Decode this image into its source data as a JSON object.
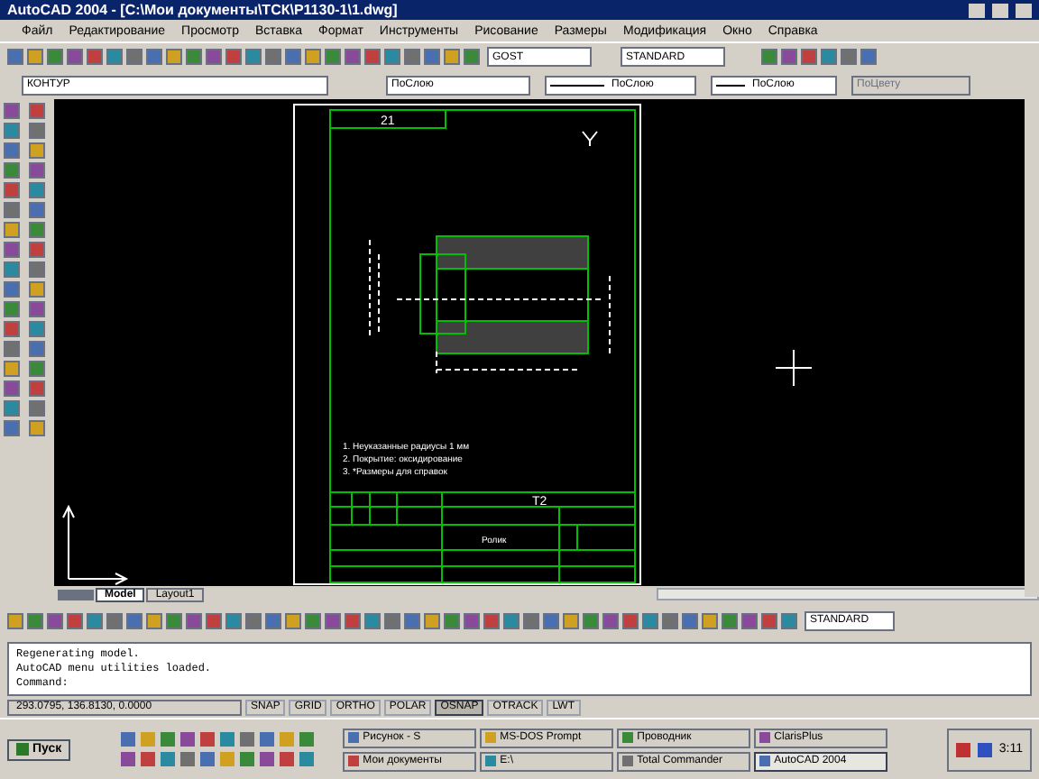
{
  "window": {
    "title": "AutoCAD 2004 - [C:\\Мои документы\\ТСК\\Р1130-1\\1.dwg]"
  },
  "menu": [
    "Файл",
    "Редактирование",
    "Просмотр",
    "Вставка",
    "Формат",
    "Инструменты",
    "Рисование",
    "Размеры",
    "Модификация",
    "Окно",
    "Справка"
  ],
  "styles": {
    "text_style": "GOST",
    "dim_style": "STANDARD"
  },
  "properties": {
    "layer": "КОНТУР",
    "color_control": "ПоСлою",
    "linetype": "ПоСлою",
    "lineweight": "ПоСлою",
    "plot_style": "ПоЦвету"
  },
  "drawing": {
    "sheet_number": "21",
    "code": "Т2",
    "part_name": "Ролик",
    "notes": [
      "1. Неуказанные радиусы 1 мм",
      "2. Покрытие: оксидирование",
      "3. *Размеры для справок"
    ]
  },
  "layout_tabs": [
    {
      "label": "Model",
      "selected": true
    },
    {
      "label": "Layout1",
      "selected": false
    }
  ],
  "bottom_style": "STANDARD",
  "command_lines": [
    "Regenerating model.",
    "AutoCAD menu utilities loaded."
  ],
  "command_prompt": "Command:",
  "status_bar": {
    "coordinates": "293.0795, 136.8130, 0.0000",
    "toggles": [
      {
        "label": "SNAP",
        "on": false
      },
      {
        "label": "GRID",
        "on": false
      },
      {
        "label": "ORTHO",
        "on": false
      },
      {
        "label": "POLAR",
        "on": false
      },
      {
        "label": "OSNAP",
        "on": true
      },
      {
        "label": "OTRACK",
        "on": false
      },
      {
        "label": "LWT",
        "on": false
      }
    ]
  },
  "taskbar": {
    "start": "Пуск",
    "tasks": [
      {
        "label": "Рисунок - S",
        "selected": false
      },
      {
        "label": "MS-DOS Prompt",
        "selected": false
      },
      {
        "label": "Проводник",
        "selected": false
      },
      {
        "label": "ClarisPlus",
        "selected": false
      },
      {
        "label": "Мои документы",
        "selected": false
      },
      {
        "label": "E:\\",
        "selected": false
      },
      {
        "label": "Total Commander",
        "selected": false
      },
      {
        "label": "AutoCAD 2004",
        "selected": true
      }
    ],
    "clock": "3:11"
  }
}
